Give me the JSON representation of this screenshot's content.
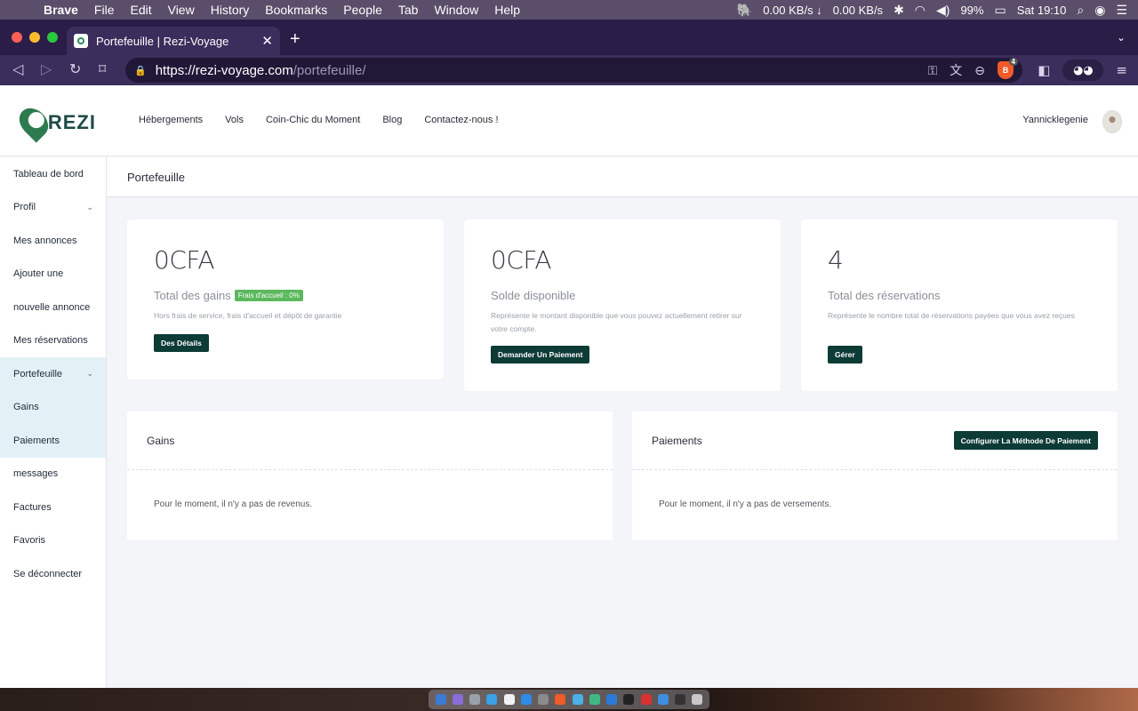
{
  "menubar": {
    "app": "Brave",
    "items": [
      "File",
      "Edit",
      "View",
      "History",
      "Bookmarks",
      "People",
      "Tab",
      "Window",
      "Help"
    ],
    "net_down": "0.00 KB/s ↓",
    "net_up": "0.00 KB/s",
    "battery": "99%",
    "clock": "Sat 19:10"
  },
  "browser": {
    "tab_title": "Portefeuille | Rezi-Voyage",
    "url_host": "https://rezi-voyage.com",
    "url_path": "/portefeuille/",
    "shield_count": "4"
  },
  "site": {
    "logo_text": "REZI",
    "nav": [
      "Hébergements",
      "Vols",
      "Coin-Chic du Moment",
      "Blog",
      "Contactez-nous !"
    ],
    "username": "Yannicklegenie"
  },
  "sidebar": {
    "items": [
      {
        "label": "Tableau de bord",
        "active": false,
        "chevron": false
      },
      {
        "label": "Profil",
        "active": false,
        "chevron": true
      },
      {
        "label": "Mes annonces",
        "active": false,
        "chevron": false
      },
      {
        "label": "Ajouter une",
        "active": false,
        "chevron": false
      },
      {
        "label": "nouvelle annonce",
        "active": false,
        "chevron": false
      },
      {
        "label": "Mes réservations",
        "active": false,
        "chevron": false
      },
      {
        "label": "Portefeuille",
        "active": true,
        "chevron": true
      },
      {
        "label": "Gains",
        "active": true,
        "chevron": false
      },
      {
        "label": "Paiements",
        "active": true,
        "chevron": false
      },
      {
        "label": "messages",
        "active": false,
        "chevron": false
      },
      {
        "label": "Factures",
        "active": false,
        "chevron": false
      },
      {
        "label": "Favoris",
        "active": false,
        "chevron": false
      },
      {
        "label": "Se déconnecter",
        "active": false,
        "chevron": false
      }
    ]
  },
  "page": {
    "title": "Portefeuille",
    "cards": [
      {
        "value": "0CFA",
        "label": "Total des gains",
        "badge": "Frais d'accueil : 0%",
        "desc": "Hors frais de service, frais d'accueil et dépôt de garantie",
        "button": "Des Détails"
      },
      {
        "value": "0CFA",
        "label": "Solde disponible",
        "desc": "Représente le montant disponible que vous pouvez actuellement retirer sur votre compte.",
        "button": "Demander Un Paiement"
      },
      {
        "value": "4",
        "label": "Total des réservations",
        "desc": "Représente le nombre total de réservations payées que vous avez reçues",
        "button": "Gérer"
      }
    ],
    "earnings_panel": {
      "title": "Gains",
      "empty": "Pour le moment, il n'y a pas de revenus."
    },
    "payments_panel": {
      "title": "Paiements",
      "button": "Configurer La Méthode De Paiement",
      "empty": "Pour le moment, il n'y a pas de versements."
    }
  },
  "colors": {
    "accent_dark": "#0d3b36",
    "badge_green": "#5bb85d",
    "active_sidebar": "#e3f1f7",
    "browser_bg": "#3b2d5c"
  }
}
